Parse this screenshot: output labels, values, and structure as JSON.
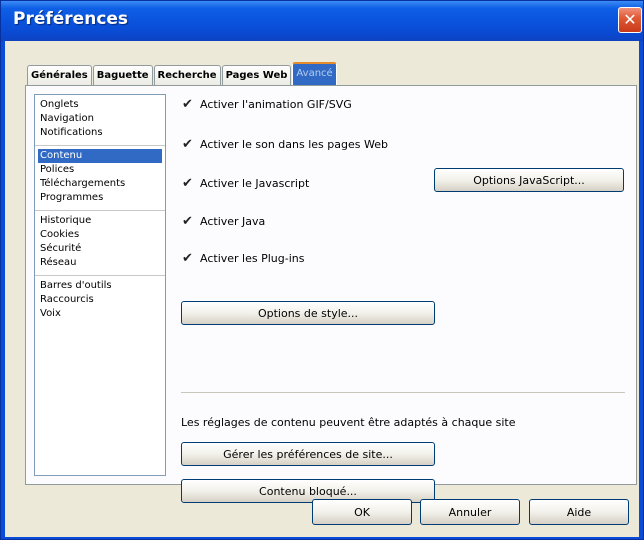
{
  "window": {
    "title": "Préférences"
  },
  "tabs": [
    {
      "label": "Générales"
    },
    {
      "label": "Baguette"
    },
    {
      "label": "Recherche"
    },
    {
      "label": "Pages Web"
    },
    {
      "label": "Avancé"
    }
  ],
  "active_tab": "Avancé",
  "sidebar": {
    "groups": [
      [
        "Onglets",
        "Navigation",
        "Notifications"
      ],
      [
        "Contenu",
        "Polices",
        "Téléchargements",
        "Programmes"
      ],
      [
        "Historique",
        "Cookies",
        "Sécurité",
        "Réseau"
      ],
      [
        "Barres d'outils",
        "Raccourcis",
        "Voix"
      ]
    ],
    "selected": "Contenu"
  },
  "content": {
    "checkboxes": [
      {
        "label": "Activer l'animation GIF/SVG",
        "checked": true
      },
      {
        "label": "Activer le son dans les pages Web",
        "checked": true
      },
      {
        "label": "Activer le Javascript",
        "checked": true
      },
      {
        "label": "Activer Java",
        "checked": true
      },
      {
        "label": "Activer les Plug-ins",
        "checked": true
      }
    ],
    "js_options_button": "Options JavaScript...",
    "style_options_button": "Options de style...",
    "info_text": "Les réglages de contenu peuvent être adaptés à chaque site",
    "manage_sites_button": "Gérer les préférences de site...",
    "blocked_content_button": "Contenu bloqué..."
  },
  "footer": {
    "ok": "OK",
    "cancel": "Annuler",
    "help": "Aide"
  },
  "icons": {
    "close": "close-icon",
    "check": "checkmark-icon"
  },
  "colors": {
    "titlebar": "#0a52dc",
    "selection": "#316ac5",
    "active_tab_accent": "#e68b2c",
    "close": "#d8461f"
  }
}
